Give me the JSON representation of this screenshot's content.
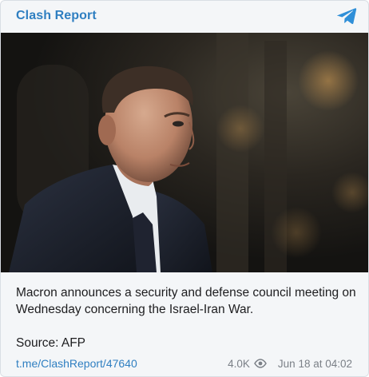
{
  "channel": {
    "name": "Clash Report",
    "icon": "telegram-icon",
    "accent_color": "#2f7fc1"
  },
  "post": {
    "image_icon": "portrait-photo",
    "text": "Macron announces a security and defense council meeting on Wednesday concerning the Israel-Iran War.",
    "source": "Source: AFP",
    "link": "t.me/ClashReport/47640",
    "views": "4.0K",
    "views_icon": "eye-icon",
    "date": "Jun 18 at 04:02"
  }
}
